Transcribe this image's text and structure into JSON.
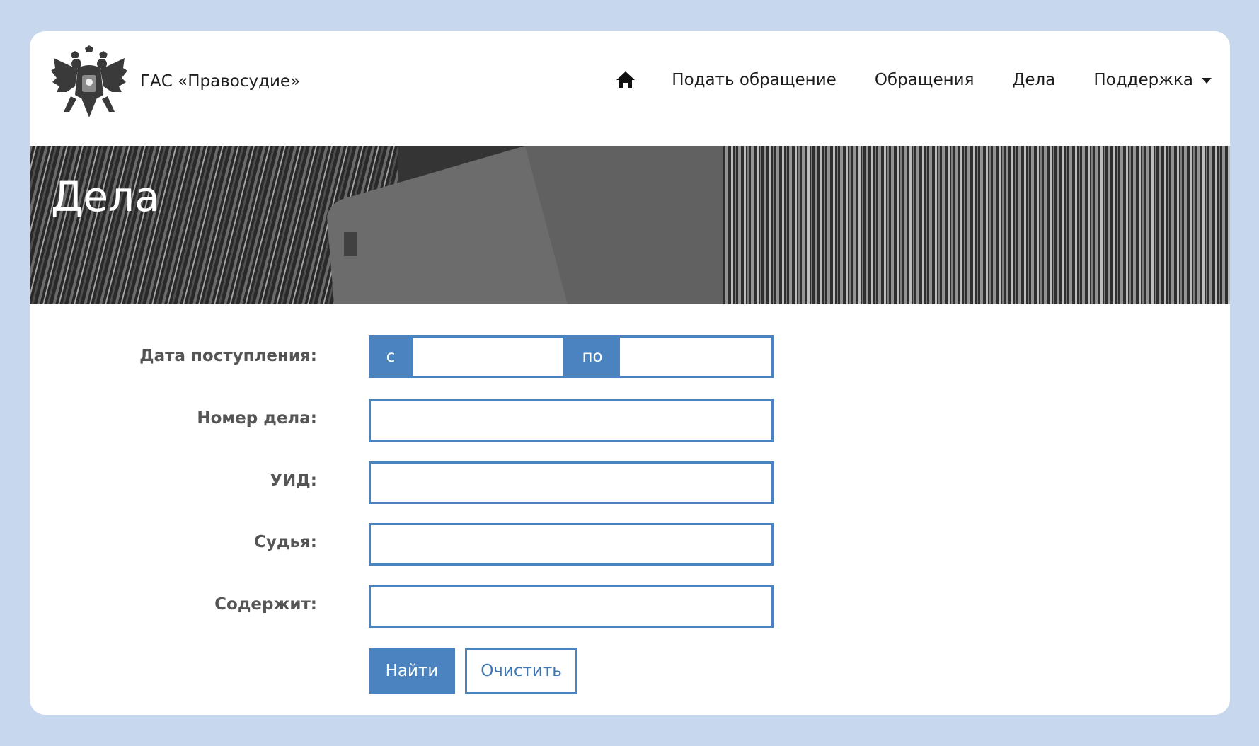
{
  "header": {
    "brand": "ГАС «Правосудие»",
    "nav": {
      "home_icon": "home-icon",
      "items": [
        "Подать обращение",
        "Обращения",
        "Дела",
        "Поддержка"
      ]
    }
  },
  "banner": {
    "title": "Дела"
  },
  "form": {
    "date_label": "Дата поступления:",
    "date_from_prefix": "с",
    "date_to_prefix": "по",
    "date_from_value": "",
    "date_to_value": "",
    "case_number_label": "Номер дела:",
    "case_number_value": "",
    "uid_label": "УИД:",
    "uid_value": "",
    "judge_label": "Судья:",
    "judge_value": "",
    "contains_label": "Содержит:",
    "contains_value": ""
  },
  "buttons": {
    "search": "Найти",
    "clear": "Очистить"
  },
  "colors": {
    "accent": "#4a83bf",
    "page_background": "#c6d7ee",
    "banner": "#3c3c3c"
  }
}
